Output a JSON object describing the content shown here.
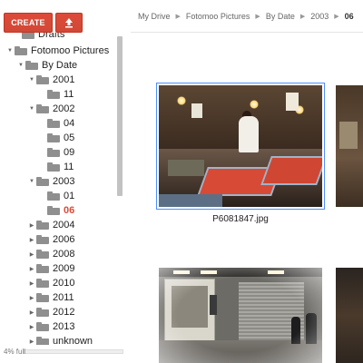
{
  "toolbar": {
    "create_label": "CREATE",
    "upload_icon": "upload-icon",
    "accent_color": "#dd4b39"
  },
  "breadcrumb": [
    "My Drive",
    "Fotomoo Pictures",
    "By Date",
    "2003",
    "06"
  ],
  "tree": {
    "partial_top_label": "Drafts",
    "root": "Fotomoo Pictures",
    "by_date": "By Date",
    "y2001": {
      "label": "2001",
      "months": [
        "11"
      ]
    },
    "y2002": {
      "label": "2002",
      "months": [
        "04",
        "05",
        "09",
        "11"
      ]
    },
    "y2003": {
      "label": "2003",
      "months": [
        "01",
        "06"
      ]
    },
    "selected_month": "06",
    "collapsed_years": [
      "2004",
      "2006",
      "2008",
      "2009",
      "2010",
      "2011",
      "2012",
      "2013",
      "unknown"
    ]
  },
  "quota": {
    "text": "4% full",
    "percent": 4
  },
  "files": [
    {
      "name": "P6081847.jpg",
      "selected": true
    }
  ]
}
